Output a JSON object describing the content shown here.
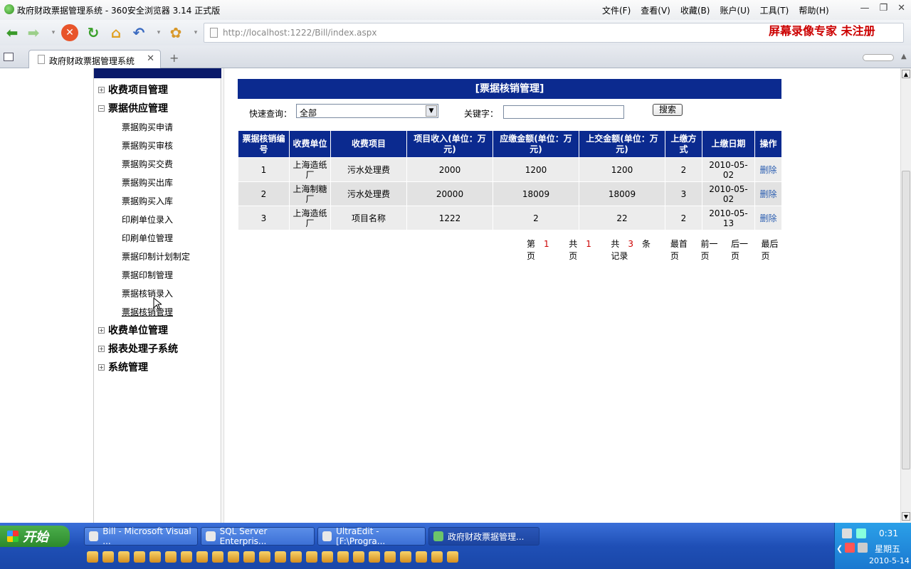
{
  "window": {
    "title": "政府财政票据管理系统 - 360安全浏览器 3.14 正式版"
  },
  "menu": [
    "文件(F)",
    "查看(V)",
    "收藏(B)",
    "账户(U)",
    "工具(T)",
    "帮助(H)"
  ],
  "address": {
    "url": "http://localhost:1222/Bill/index.aspx"
  },
  "watermark": "屏幕录像专家 未注册",
  "tab": {
    "label": "政府财政票据管理系统"
  },
  "nav": {
    "groups": [
      {
        "label": "收费项目管理",
        "expanded": false
      },
      {
        "label": "票据供应管理",
        "expanded": true
      },
      {
        "label": "收费单位管理",
        "expanded": false
      },
      {
        "label": "报表处理子系统",
        "expanded": false
      },
      {
        "label": "系统管理",
        "expanded": false
      }
    ],
    "subitems": [
      "票据购买申请",
      "票据购买审核",
      "票据购买交费",
      "票据购买出库",
      "票据购买入库",
      "印刷单位录入",
      "印刷单位管理",
      "票据印制计划制定",
      "票据印制管理",
      "票据核销录入",
      "票据核销管理"
    ]
  },
  "panel": {
    "title": "[票据核销管理]"
  },
  "search": {
    "quick_label": "快速查询：",
    "quick_value": "全部",
    "keyword_label": "关键字：",
    "keyword_value": "",
    "button": "搜索"
  },
  "table": {
    "headers": [
      "票据核销编号",
      "收费单位",
      "收费项目",
      "项目收入(单位：万元)",
      "应缴金额(单位：万元)",
      "上交金额(单位：万元)",
      "上缴方式",
      "上缴日期",
      "操作"
    ],
    "rows": [
      [
        "1",
        "上海造纸厂",
        "污水处理费",
        "2000",
        "1200",
        "1200",
        "2",
        "2010-05-02",
        "删除"
      ],
      [
        "2",
        "上海制糖厂",
        "污水处理费",
        "20000",
        "18009",
        "18009",
        "3",
        "2010-05-02",
        "删除"
      ],
      [
        "3",
        "上海造纸厂",
        "项目名称",
        "1222",
        "2",
        "22",
        "2",
        "2010-05-13",
        "删除"
      ]
    ]
  },
  "pager": {
    "page_prefix": "第",
    "page_no": "1",
    "page_suffix": "页",
    "total_prefix": "共",
    "total_pages": "1",
    "total_suffix": "页",
    "rec_prefix": "共",
    "records": "3",
    "rec_suffix": "条记录",
    "first": "最首页",
    "prev": "前一页",
    "next": "后一页",
    "last": "最后页"
  },
  "taskbar": {
    "start": "开始",
    "tasks": [
      "Bill - Microsoft Visual ...",
      "SQL Server Enterpris...",
      "UltraEdit - [F:\\Progra...",
      "政府财政票据管理..."
    ],
    "time": "0:31",
    "weekday": "星期五",
    "date": "2010-5-14"
  }
}
